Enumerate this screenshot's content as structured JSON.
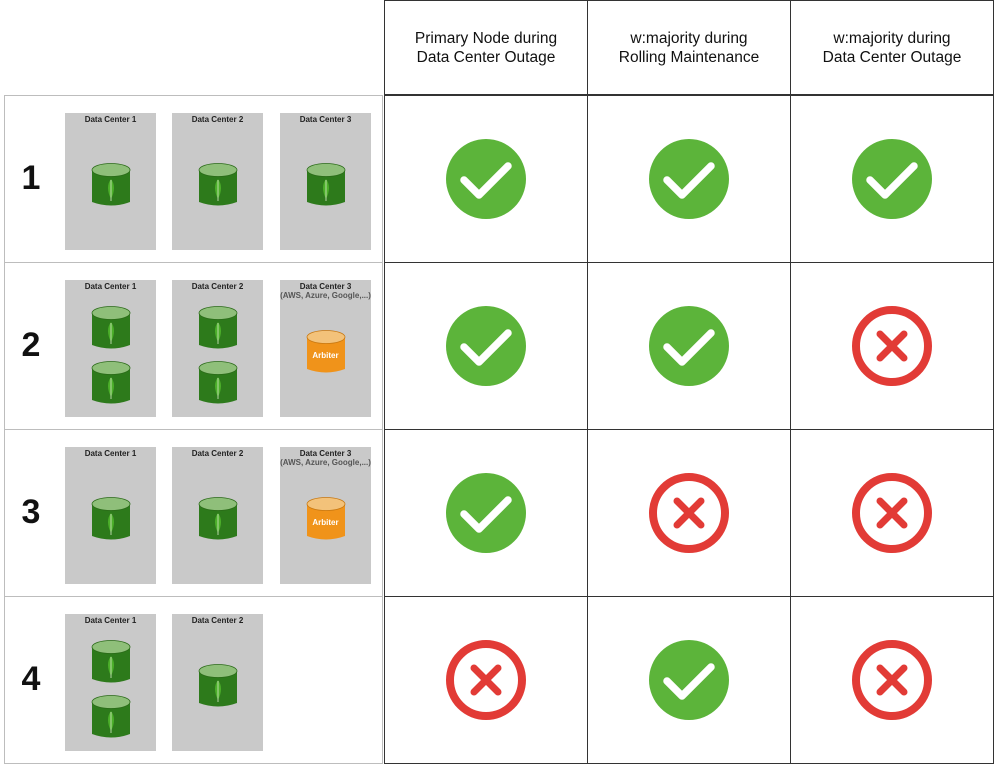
{
  "headers": [
    "Primary Node during\nData Center Outage",
    "w:majority during\nRolling Maintenance",
    "w:majority during\nData Center Outage"
  ],
  "rows": [
    {
      "number": "1",
      "data_centers": [
        {
          "label": "Data Center 1",
          "sublabel": "",
          "nodes": [
            "mongodb"
          ]
        },
        {
          "label": "Data Center 2",
          "sublabel": "",
          "nodes": [
            "mongodb"
          ]
        },
        {
          "label": "Data Center 3",
          "sublabel": "",
          "nodes": [
            "mongodb"
          ]
        }
      ],
      "results": [
        "check",
        "check",
        "check"
      ]
    },
    {
      "number": "2",
      "data_centers": [
        {
          "label": "Data Center 1",
          "sublabel": "",
          "nodes": [
            "mongodb",
            "mongodb"
          ]
        },
        {
          "label": "Data Center 2",
          "sublabel": "",
          "nodes": [
            "mongodb",
            "mongodb"
          ]
        },
        {
          "label": "Data Center 3",
          "sublabel": "(AWS, Azure, Google,...)",
          "nodes": [
            "arbiter"
          ]
        }
      ],
      "results": [
        "check",
        "check",
        "cross"
      ]
    },
    {
      "number": "3",
      "data_centers": [
        {
          "label": "Data Center 1",
          "sublabel": "",
          "nodes": [
            "mongodb"
          ]
        },
        {
          "label": "Data Center 2",
          "sublabel": "",
          "nodes": [
            "mongodb"
          ]
        },
        {
          "label": "Data Center 3",
          "sublabel": "(AWS, Azure, Google,...)",
          "nodes": [
            "arbiter"
          ]
        }
      ],
      "results": [
        "check",
        "cross",
        "cross"
      ]
    },
    {
      "number": "4",
      "data_centers": [
        {
          "label": "Data Center 1",
          "sublabel": "",
          "nodes": [
            "mongodb",
            "mongodb"
          ]
        },
        {
          "label": "Data Center 2",
          "sublabel": "",
          "nodes": [
            "mongodb"
          ]
        }
      ],
      "results": [
        "cross",
        "check",
        "cross"
      ]
    }
  ],
  "arbiter_label": "Arbiter",
  "colors": {
    "check": "#5cb43a",
    "cross": "#e23b36",
    "mongodb_green": "#2d7a1b",
    "mongodb_leaf": "#4caf2a",
    "arbiter_orange": "#f0931a",
    "datacenter_bg": "#c9c9c9"
  }
}
